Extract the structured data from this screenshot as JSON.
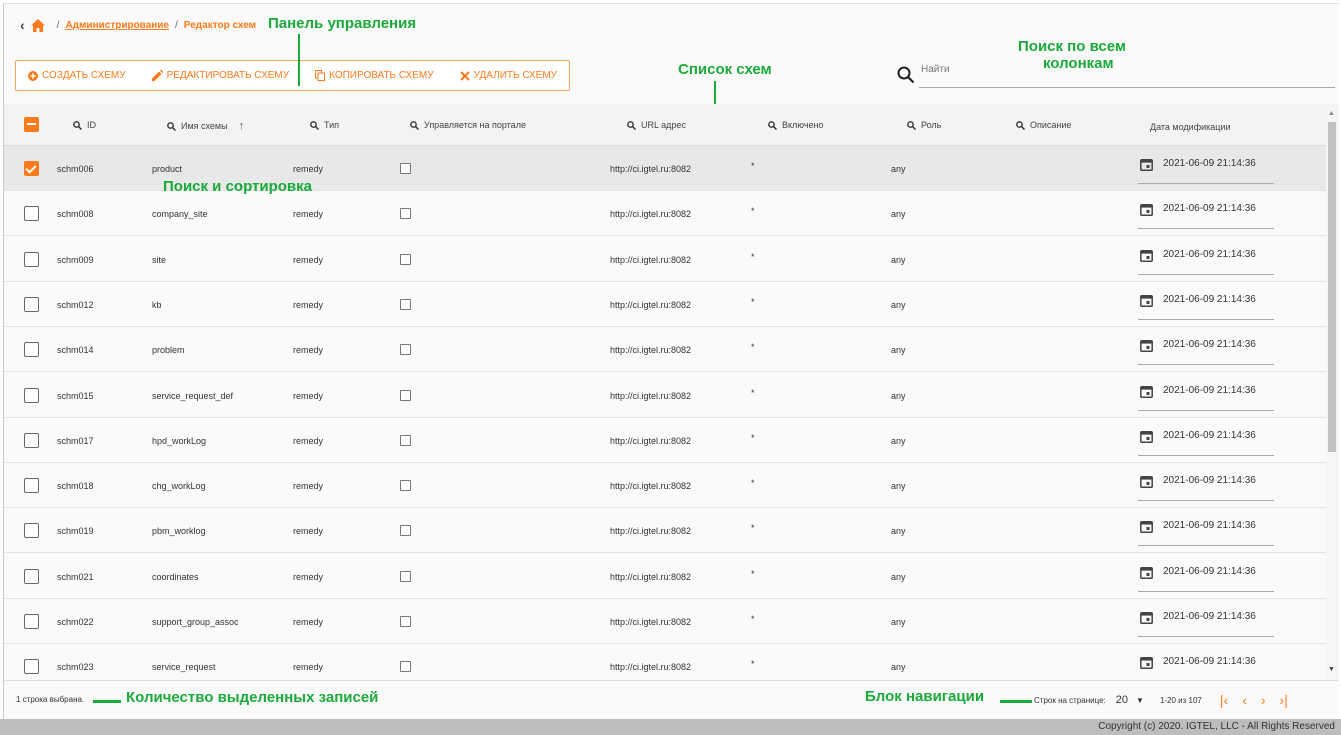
{
  "breadcrumb": {
    "admin": "Администрирование",
    "current": "Редактор схем"
  },
  "toolbar": {
    "create": "СОЗДАТЬ СХЕМУ",
    "edit": "РЕДАКТИРОВАТЬ СХЕМУ",
    "copy": "КОПИРОВАТЬ СХЕМУ",
    "delete": "УДАЛИТЬ СХЕМУ"
  },
  "search": {
    "placeholder": "Найти"
  },
  "annotations": {
    "panel": "Панель управления",
    "search_all_1": "Поиск по всем",
    "search_all_2": "колонкам",
    "list": "Список схем",
    "search_sort": "Поиск и сортировка",
    "selected_count": "Количество выделенных записей",
    "nav_block": "Блок навигации"
  },
  "columns": {
    "id": "ID",
    "name": "Имя схемы",
    "type": "Тип",
    "portal": "Управляется на портале",
    "url": "URL адрес",
    "enabled": "Включено",
    "role": "Роль",
    "description": "Описание",
    "modified": "Дата модификации"
  },
  "rows": [
    {
      "id": "schm006",
      "name": "product",
      "type": "remedy",
      "url": "http://ci.igtel.ru:8082",
      "enabled": "*",
      "role": "any",
      "date": "2021-06-09 21:14:36"
    },
    {
      "id": "schm008",
      "name": "company_site",
      "type": "remedy",
      "url": "http://ci.igtel.ru:8082",
      "enabled": "*",
      "role": "any",
      "date": "2021-06-09 21:14:36"
    },
    {
      "id": "schm009",
      "name": "site",
      "type": "remedy",
      "url": "http://ci.igtel.ru:8082",
      "enabled": "*",
      "role": "any",
      "date": "2021-06-09 21:14:36"
    },
    {
      "id": "schm012",
      "name": "kb",
      "type": "remedy",
      "url": "http://ci.igtel.ru:8082",
      "enabled": "*",
      "role": "any",
      "date": "2021-06-09 21:14:36"
    },
    {
      "id": "schm014",
      "name": "problem",
      "type": "remedy",
      "url": "http://ci.igtel.ru:8082",
      "enabled": "*",
      "role": "any",
      "date": "2021-06-09 21:14:36"
    },
    {
      "id": "schm015",
      "name": "service_request_def",
      "type": "remedy",
      "url": "http://ci.igtel.ru:8082",
      "enabled": "*",
      "role": "any",
      "date": "2021-06-09 21:14:36"
    },
    {
      "id": "schm017",
      "name": "hpd_workLog",
      "type": "remedy",
      "url": "http://ci.igtel.ru:8082",
      "enabled": "*",
      "role": "any",
      "date": "2021-06-09 21:14:36"
    },
    {
      "id": "schm018",
      "name": "chg_workLog",
      "type": "remedy",
      "url": "http://ci.igtel.ru:8082",
      "enabled": "*",
      "role": "any",
      "date": "2021-06-09 21:14:36"
    },
    {
      "id": "schm019",
      "name": "pbm_worklog",
      "type": "remedy",
      "url": "http://ci.igtel.ru:8082",
      "enabled": "*",
      "role": "any",
      "date": "2021-06-09 21:14:36"
    },
    {
      "id": "schm021",
      "name": "coordinates",
      "type": "remedy",
      "url": "http://ci.igtel.ru:8082",
      "enabled": "*",
      "role": "any",
      "date": "2021-06-09 21:14:36"
    },
    {
      "id": "schm022",
      "name": "support_group_assoc",
      "type": "remedy",
      "url": "http://ci.igtel.ru:8082",
      "enabled": "*",
      "role": "any",
      "date": "2021-06-09 21:14:36"
    },
    {
      "id": "schm023",
      "name": "service_request",
      "type": "remedy",
      "url": "http://ci.igtel.ru:8082",
      "enabled": "*",
      "role": "any",
      "date": "2021-06-09 21:14:36"
    }
  ],
  "footer": {
    "selected": "1 строка выбрана.",
    "rows_per_page_label": "Строк на странице:",
    "rows_per_page": "20",
    "range": "1-20 из 107"
  },
  "copyright": "Copyright (c) 2020. IGTEL, LLC - All Rights Reserved",
  "colors": {
    "accent": "#ff7a1a",
    "annotation": "#1aaa3a"
  },
  "icons": {
    "back": "chevron-left-icon",
    "home": "home-icon",
    "create": "add-circle-icon",
    "edit": "pencil-icon",
    "copy": "copy-icon",
    "delete": "close-icon",
    "search": "search-icon",
    "calendar": "calendar-icon"
  }
}
